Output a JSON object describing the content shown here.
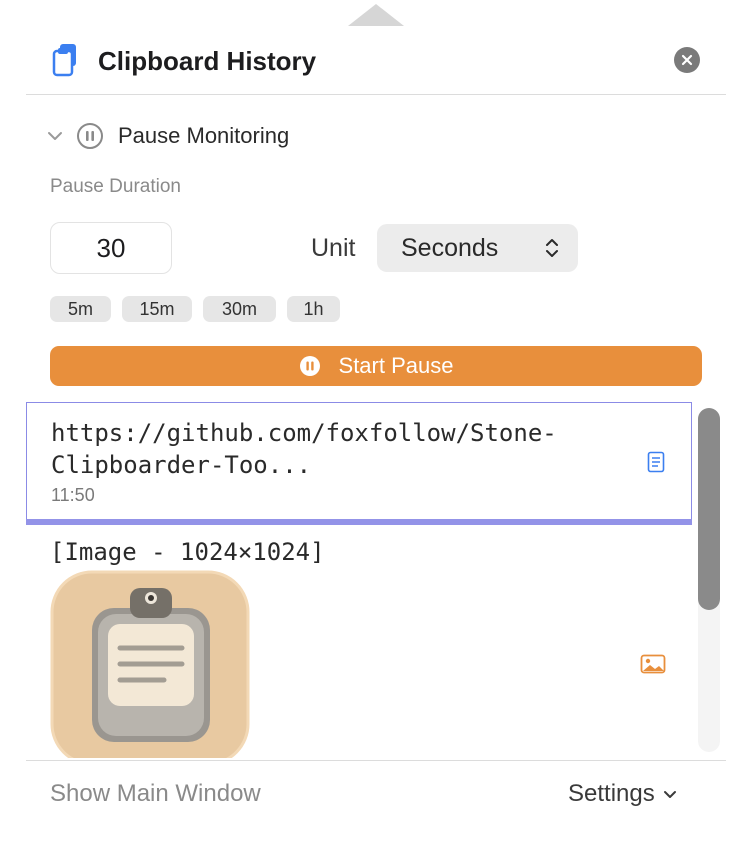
{
  "header": {
    "title": "Clipboard History"
  },
  "pause": {
    "toggle_label": "Pause Monitoring",
    "duration_label": "Pause Duration",
    "duration_value": "30",
    "unit_label": "Unit",
    "unit_value": "Seconds",
    "presets": [
      "5m",
      "15m",
      "30m",
      "1h"
    ],
    "start_label": "Start Pause"
  },
  "history": {
    "items": [
      {
        "type": "text",
        "text": "https://github.com/foxfollow/Stone-Clipboarder-Too...",
        "time": "11:50"
      },
      {
        "type": "image",
        "text": "[Image - 1024×1024]"
      }
    ]
  },
  "footer": {
    "show_main": "Show Main Window",
    "settings": "Settings"
  },
  "colors": {
    "accent": "#e88f3c",
    "selection": "#8b8be6",
    "icon_blue": "#3b7ff0"
  },
  "icons": [
    "clipboard-app-icon",
    "close-icon",
    "chevron-down-icon",
    "pause-circle-icon",
    "up-down-chevron-icon",
    "document-icon",
    "image-icon"
  ]
}
